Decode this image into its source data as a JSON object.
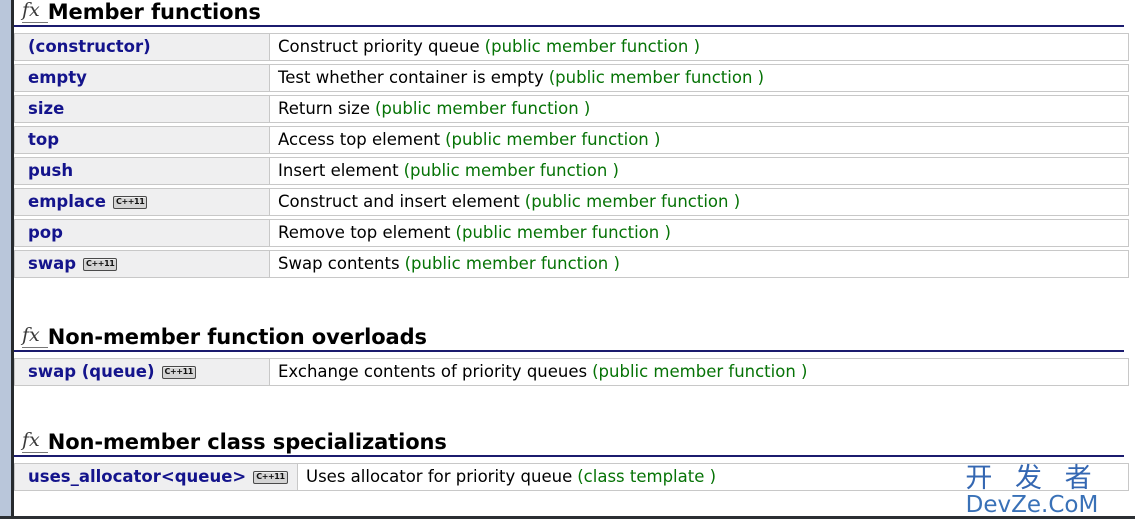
{
  "colors": {
    "link": "#14148c",
    "kind": "#067306",
    "heading_rule": "#1b1b6e",
    "cell_bg": "#efeff0",
    "cell_border": "#c8c8c8",
    "left_strip": "#b9c6da",
    "watermark": "#2a5fae"
  },
  "sections": [
    {
      "icon": "fx",
      "title": "Member functions",
      "rows": [
        {
          "name": "(constructor)",
          "badge": "",
          "desc": "Construct priority queue",
          "kind": "(public member function )"
        },
        {
          "name": "empty",
          "badge": "",
          "desc": "Test whether container is empty",
          "kind": "(public member function )"
        },
        {
          "name": "size",
          "badge": "",
          "desc": "Return size",
          "kind": "(public member function )"
        },
        {
          "name": "top",
          "badge": "",
          "desc": "Access top element",
          "kind": "(public member function )"
        },
        {
          "name": "push",
          "badge": "",
          "desc": "Insert element",
          "kind": "(public member function )"
        },
        {
          "name": "emplace",
          "badge": "C++11",
          "desc": "Construct and insert element",
          "kind": "(public member function )"
        },
        {
          "name": "pop",
          "badge": "",
          "desc": "Remove top element",
          "kind": "(public member function )"
        },
        {
          "name": "swap",
          "badge": "C++11",
          "desc": "Swap contents",
          "kind": "(public member function )"
        }
      ]
    },
    {
      "icon": "fx",
      "title": "Non-member function overloads",
      "rows": [
        {
          "name": "swap (queue)",
          "badge": "C++11",
          "desc": "Exchange contents of priority queues",
          "kind": "(public member function )"
        }
      ]
    },
    {
      "icon": "fx",
      "title": "Non-member class specializations",
      "rows": [
        {
          "name": "uses_allocator<queue>",
          "badge": "C++11",
          "desc": "Uses allocator for priority queue",
          "kind": "(class template )"
        }
      ]
    }
  ],
  "watermark": {
    "cn": "开 发 者",
    "en": "DevZe.CoM"
  }
}
